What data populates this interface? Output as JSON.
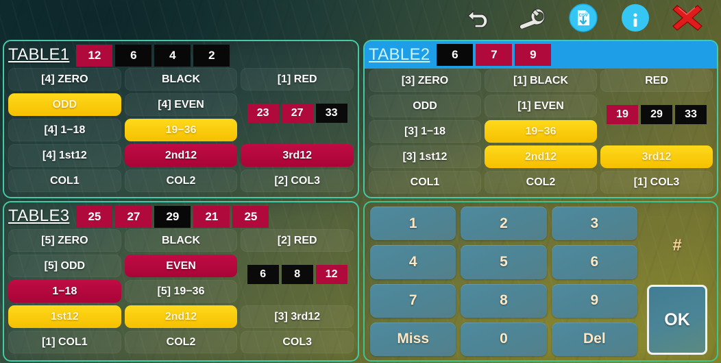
{
  "toolbar": {
    "icons": [
      {
        "name": "undo-icon",
        "label": "Undo"
      },
      {
        "name": "wrench-icon",
        "label": "Settings"
      },
      {
        "name": "csv-export-icon",
        "label": "CSV"
      },
      {
        "name": "info-icon",
        "label": "Info"
      },
      {
        "name": "close-icon",
        "label": "Close"
      }
    ]
  },
  "colors": {
    "red": "#b00a3d",
    "black": "#080808",
    "yellow": "#ffd91c",
    "crimson": "#bf0c44",
    "blue_highlight": "#1f9ee8",
    "panel_border": "#46c9a6",
    "key": "#4f8a9e"
  },
  "tables": [
    {
      "id": "table1",
      "name": "TABLE1",
      "highlighted": false,
      "history": [
        {
          "value": "12",
          "color": "red"
        },
        {
          "value": "6",
          "color": "black"
        },
        {
          "value": "4",
          "color": "black"
        },
        {
          "value": "2",
          "color": "black"
        }
      ],
      "chips": [
        {
          "value": "23",
          "color": "red"
        },
        {
          "value": "27",
          "color": "red"
        },
        {
          "value": "33",
          "color": "black"
        }
      ],
      "rows": [
        [
          {
            "label": "[4] ZERO",
            "state": "off"
          },
          {
            "label": "BLACK",
            "state": "off"
          },
          {
            "label": "[1] RED",
            "state": "off"
          }
        ],
        [
          {
            "label": "ODD",
            "state": "yellow"
          },
          {
            "label": "[4] EVEN",
            "state": "off"
          },
          {
            "label": "__CHIPS__",
            "state": "chips"
          }
        ],
        [
          {
            "label": "[4] 1−18",
            "state": "off"
          },
          {
            "label": "19−36",
            "state": "yellow"
          },
          {
            "label": "__CHIPS__",
            "state": "chips"
          }
        ],
        [
          {
            "label": "[4] 1st12",
            "state": "off"
          },
          {
            "label": "2nd12",
            "state": "crimson"
          },
          {
            "label": "3rd12",
            "state": "crimson"
          }
        ],
        [
          {
            "label": "COL1",
            "state": "off"
          },
          {
            "label": "COL2",
            "state": "off"
          },
          {
            "label": "[2] COL3",
            "state": "off"
          }
        ]
      ]
    },
    {
      "id": "table2",
      "name": "TABLE2",
      "highlighted": true,
      "history": [
        {
          "value": "6",
          "color": "black"
        },
        {
          "value": "7",
          "color": "red"
        },
        {
          "value": "9",
          "color": "red"
        }
      ],
      "chips": [
        {
          "value": "19",
          "color": "red"
        },
        {
          "value": "29",
          "color": "black"
        },
        {
          "value": "33",
          "color": "black"
        }
      ],
      "rows": [
        [
          {
            "label": "[3] ZERO",
            "state": "off"
          },
          {
            "label": "[1] BLACK",
            "state": "off"
          },
          {
            "label": "RED",
            "state": "off"
          }
        ],
        [
          {
            "label": "ODD",
            "state": "off"
          },
          {
            "label": "[1] EVEN",
            "state": "off"
          },
          {
            "label": "__CHIPS__",
            "state": "chips"
          }
        ],
        [
          {
            "label": "[3] 1−18",
            "state": "off"
          },
          {
            "label": "19−36",
            "state": "yellow"
          },
          {
            "label": "__CHIPS__",
            "state": "chips"
          }
        ],
        [
          {
            "label": "[3] 1st12",
            "state": "off"
          },
          {
            "label": "2nd12",
            "state": "yellow"
          },
          {
            "label": "3rd12",
            "state": "yellow"
          }
        ],
        [
          {
            "label": "COL1",
            "state": "off"
          },
          {
            "label": "COL2",
            "state": "off"
          },
          {
            "label": "[1] COL3",
            "state": "off"
          }
        ]
      ]
    },
    {
      "id": "table3",
      "name": "TABLE3",
      "highlighted": false,
      "history": [
        {
          "value": "25",
          "color": "red"
        },
        {
          "value": "27",
          "color": "red"
        },
        {
          "value": "29",
          "color": "black"
        },
        {
          "value": "21",
          "color": "red"
        },
        {
          "value": "25",
          "color": "red"
        }
      ],
      "chips": [
        {
          "value": "6",
          "color": "black"
        },
        {
          "value": "8",
          "color": "black"
        },
        {
          "value": "12",
          "color": "red"
        }
      ],
      "rows": [
        [
          {
            "label": "[5] ZERO",
            "state": "off"
          },
          {
            "label": "BLACK",
            "state": "off"
          },
          {
            "label": "[2] RED",
            "state": "off"
          }
        ],
        [
          {
            "label": "[5] ODD",
            "state": "off"
          },
          {
            "label": "EVEN",
            "state": "crimson"
          },
          {
            "label": "__CHIPS__",
            "state": "chips"
          }
        ],
        [
          {
            "label": "1−18",
            "state": "crimson"
          },
          {
            "label": "[5] 19−36",
            "state": "off"
          },
          {
            "label": "__CHIPS__",
            "state": "chips"
          }
        ],
        [
          {
            "label": "1st12",
            "state": "yellow"
          },
          {
            "label": "2nd12",
            "state": "yellow"
          },
          {
            "label": "[3] 3rd12",
            "state": "off"
          }
        ],
        [
          {
            "label": "[1] COL1",
            "state": "off"
          },
          {
            "label": "COL2",
            "state": "off"
          },
          {
            "label": "COL3",
            "state": "off"
          }
        ]
      ]
    }
  ],
  "keypad": {
    "keys": [
      "1",
      "2",
      "3",
      "4",
      "5",
      "6",
      "7",
      "8",
      "9",
      "Miss",
      "0",
      "Del"
    ],
    "display": "#",
    "ok_label": "OK"
  }
}
